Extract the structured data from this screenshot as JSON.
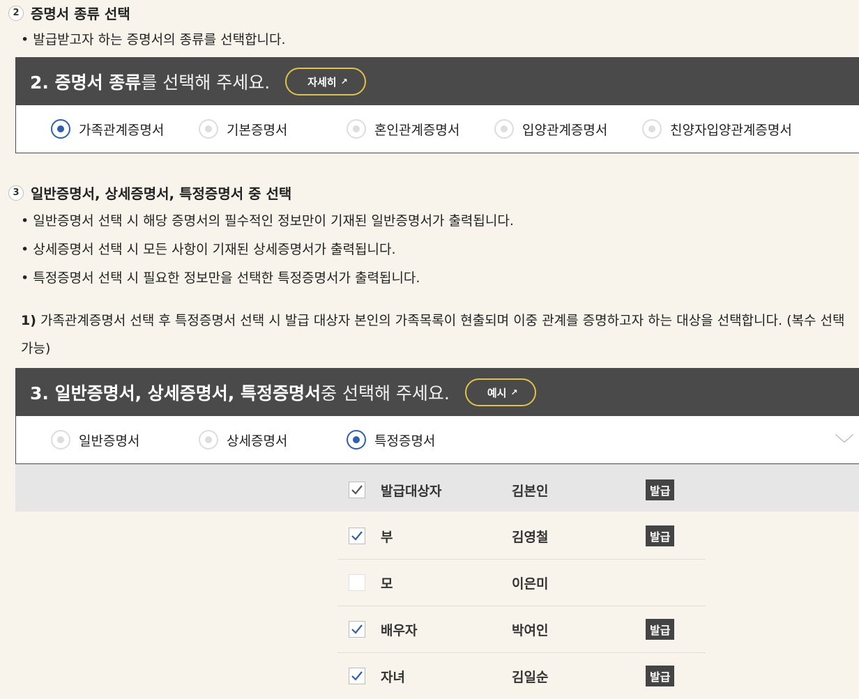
{
  "section2": {
    "num": "2",
    "title": "증명서 종류 선택",
    "bullet": "발급받고자 하는 증명서의 종류를 선택합니다.",
    "panel": {
      "num_title": "2. 증명서 종류",
      "rest": "를 선택해 주세요.",
      "button": "자세히",
      "button_icon": "external-link-icon",
      "options": [
        "가족관계증명서",
        "기본증명서",
        "혼인관계증명서",
        "입양관계증명서",
        "친양자입양관계증명서"
      ],
      "selected": "가족관계증명서"
    }
  },
  "section3": {
    "num": "3",
    "title": "일반증명서, 상세증명서, 특정증명서 중 선택",
    "bullets": [
      "일반증명서 선택 시 해당 증명서의 필수적인 정보만이 기재된 일반증명서가 출력됩니다.",
      "상세증명서 선택 시 모든 사항이 기재된 상세증명서가 출력됩니다.",
      "특정증명서 선택 시 필요한 정보만을 선택한 특정증명서가 출력됩니다."
    ],
    "note_prefix": "1)",
    "note": "가족관계증명서 선택 후 특정증명서 선택 시 발급 대상자 본인의 가족목록이 현출되며 이중 관계를 증명하고자 하는 대상을 선택합니다. (복수 선택 가능)",
    "panel": {
      "num_title": "3. 일반증명서, 상세증명서, 특정증명서",
      "rest": " 중 선택해 주세요.",
      "button": "예시",
      "button_icon": "external-link-icon",
      "options": [
        "일반증명서",
        "상세증명서",
        "특정증명서"
      ],
      "selected": "특정증명서",
      "toggle_icon": "chevron-down-icon"
    },
    "family": [
      {
        "relation": "발급대상자",
        "name": "김본인",
        "checked": true,
        "issue": "발급"
      },
      {
        "relation": "부",
        "name": "김영철",
        "checked": true,
        "issue": "발급"
      },
      {
        "relation": "모",
        "name": "이은미",
        "checked": false,
        "issue": ""
      },
      {
        "relation": "배우자",
        "name": "박여인",
        "checked": true,
        "issue": "발급"
      },
      {
        "relation": "자녀",
        "name": "김일순",
        "checked": true,
        "issue": "발급"
      }
    ],
    "colors": {
      "header": "#4a4a4a",
      "accent": "#2f5fae",
      "button_border": "#e2c24a",
      "background": "#f8f4ec"
    }
  }
}
